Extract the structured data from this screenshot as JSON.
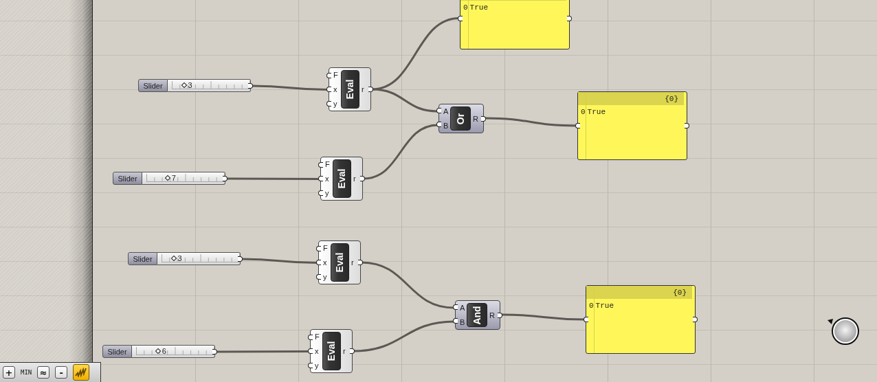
{
  "sliders": [
    {
      "label": "Slider",
      "value": "3",
      "level": 0.15
    },
    {
      "label": "Slider",
      "value": "7",
      "level": 0.27
    },
    {
      "label": "Slider",
      "value": "3",
      "level": 0.15
    },
    {
      "label": "Slider",
      "value": "6",
      "level": 0.28
    }
  ],
  "components": [
    {
      "kind": "eval",
      "name": "Eval",
      "inputs": [
        "F",
        "x",
        "y"
      ],
      "output": "r"
    },
    {
      "kind": "eval",
      "name": "Eval",
      "inputs": [
        "F",
        "x",
        "y"
      ],
      "output": "r"
    },
    {
      "kind": "eval",
      "name": "Eval",
      "inputs": [
        "F",
        "x",
        "y"
      ],
      "output": "r"
    },
    {
      "kind": "eval",
      "name": "Eval",
      "inputs": [
        "F",
        "x",
        "y"
      ],
      "output": "r"
    },
    {
      "kind": "gate",
      "name": "Or",
      "inputs": [
        "A",
        "B"
      ],
      "output": "R"
    },
    {
      "kind": "gate",
      "name": "And",
      "inputs": [
        "A",
        "B"
      ],
      "output": "R"
    }
  ],
  "panels": [
    {
      "rows": [
        {
          "index": "0",
          "value": "True"
        }
      ]
    },
    {
      "header": "{0}",
      "rows": [
        {
          "index": "0",
          "value": "True"
        }
      ]
    },
    {
      "header": "{0}",
      "rows": [
        {
          "index": "0",
          "value": "True"
        }
      ]
    }
  ],
  "toolbar": [
    {
      "kind": "button",
      "label": "+",
      "selected": false
    },
    {
      "kind": "text",
      "label": "MIN",
      "selected": false
    },
    {
      "kind": "button",
      "label": "≈",
      "selected": false
    },
    {
      "kind": "button",
      "label": "-",
      "selected": false
    },
    {
      "kind": "icon",
      "selected": true
    }
  ]
}
